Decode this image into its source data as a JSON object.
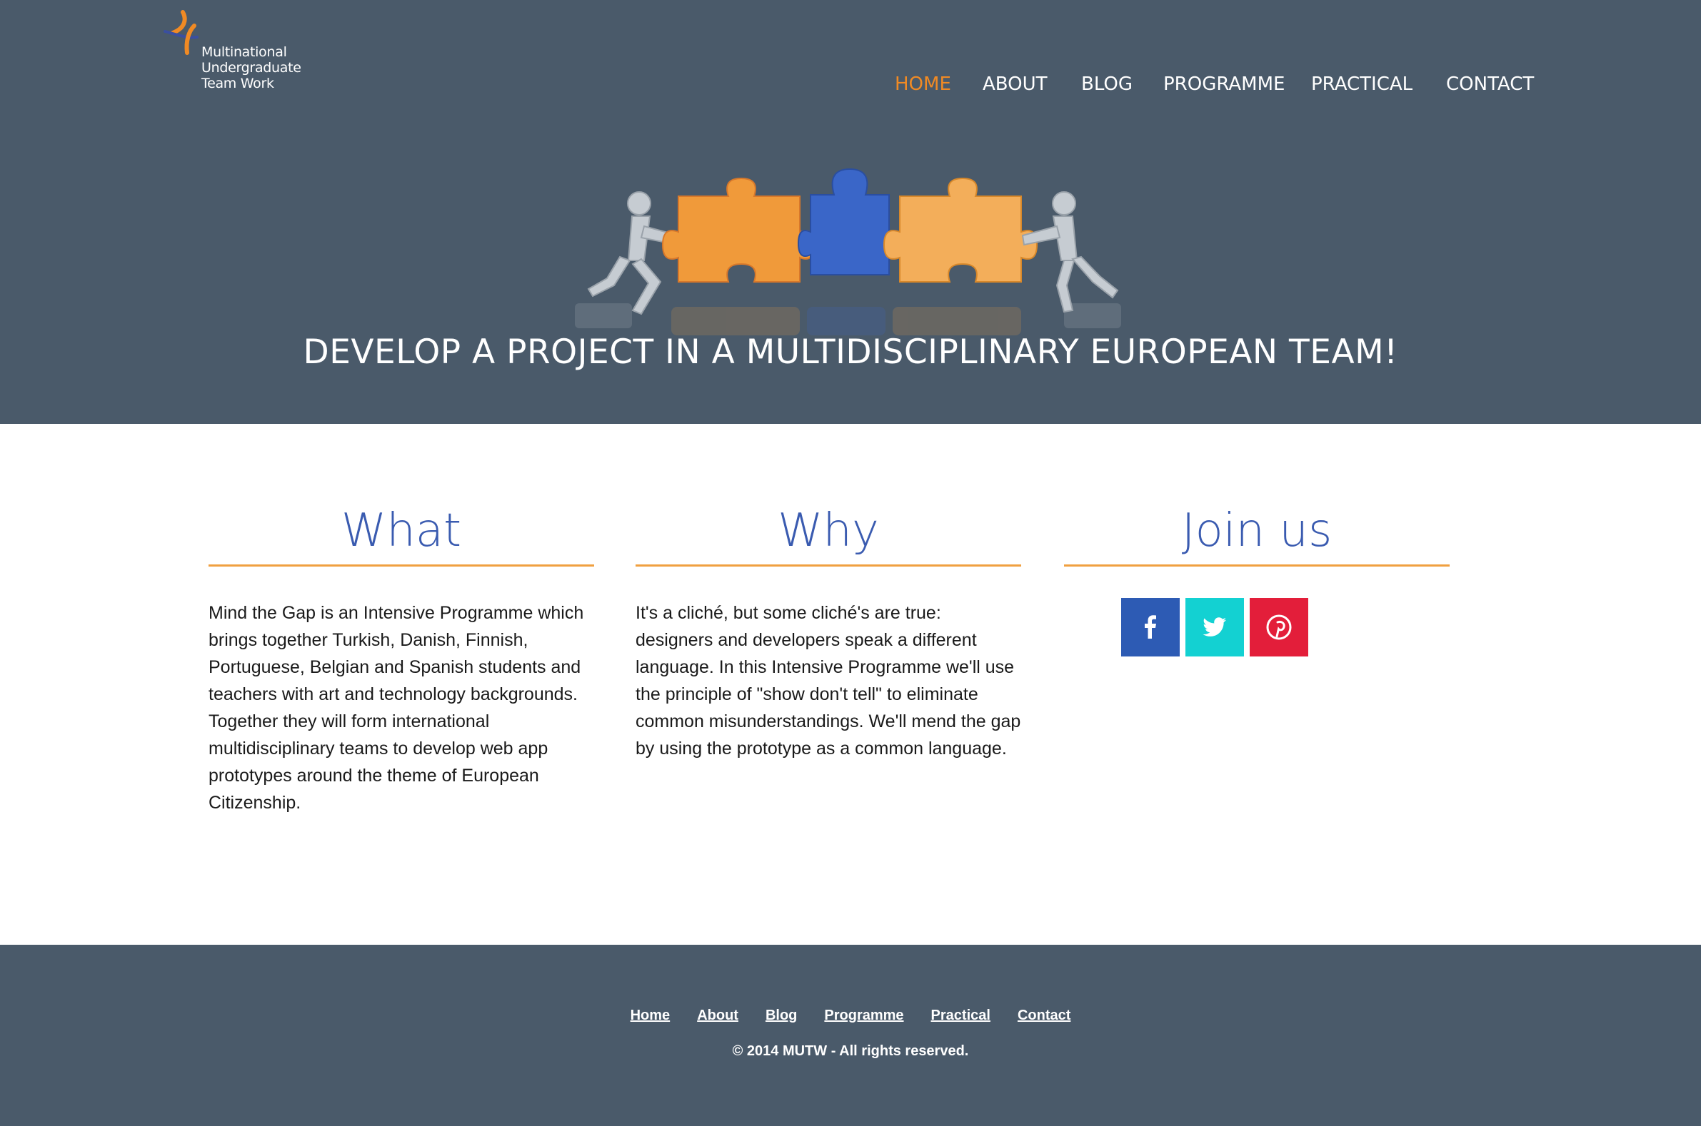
{
  "logo": {
    "lines": [
      "Multinational",
      "Undergraduate",
      "Team Work"
    ]
  },
  "nav": {
    "items": [
      {
        "label": "HOME",
        "active": true
      },
      {
        "label": "ABOUT",
        "active": false
      },
      {
        "label": "BLOG",
        "active": false
      },
      {
        "label": "PROGRAMME",
        "active": false
      },
      {
        "label": "PRACTICAL",
        "active": false
      },
      {
        "label": "CONTACT",
        "active": false
      }
    ]
  },
  "hero": {
    "title": "DEVELOP A PROJECT IN A MULTIDISCIPLINARY EUROPEAN TEAM!"
  },
  "columns": [
    {
      "heading": "What",
      "body": "Mind the Gap is an Intensive Programme which brings together Turkish, Danish, Finnish, Portuguese, Belgian and Spanish students and teachers with art and technology backgrounds. Together they will form international multidisciplinary teams to develop web app prototypes around the theme of European Citizenship."
    },
    {
      "heading": "Why",
      "body": "It's a cliché, but some cliché's are true: designers and developers speak a different language. In this Intensive Programme we'll use the principle of \"show don't tell\" to eliminate common misunderstandings. We'll mend the gap by using the prototype as a common language."
    },
    {
      "heading": "Join us",
      "body": ""
    }
  ],
  "social": [
    {
      "icon": "facebook-icon",
      "color": "#2d5bb4"
    },
    {
      "icon": "twitter-icon",
      "color": "#13d1d2"
    },
    {
      "icon": "pinterest-icon",
      "color": "#e31e3a"
    }
  ],
  "footer": {
    "links": [
      "Home",
      "About",
      "Blog",
      "Programme",
      "Practical",
      "Contact"
    ],
    "copyright": "© 2014 MUTW - All rights reserved."
  },
  "colors": {
    "header_bg": "#4a5a6a",
    "accent_orange": "#f08a24",
    "heading_blue": "#3a5bb0",
    "rule_orange": "#f0a040"
  }
}
